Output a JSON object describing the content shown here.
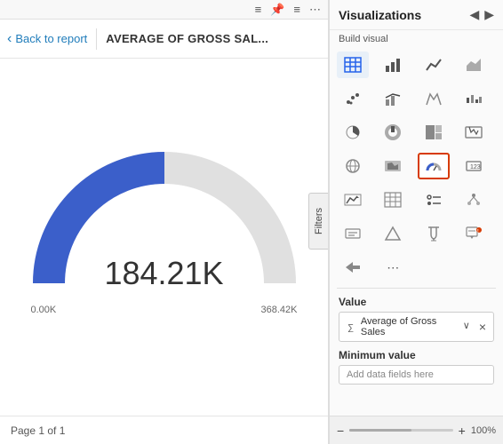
{
  "toolbar": {
    "icons": [
      "≡",
      "📌",
      "≡",
      "…"
    ]
  },
  "nav": {
    "back_label": "Back to report",
    "title": "AVERAGE OF GROSS SAL..."
  },
  "chart": {
    "value": "184.21K",
    "min_label": "0.00K",
    "max_label": "368.42K"
  },
  "filters": {
    "label": "Filters"
  },
  "footer": {
    "page_label": "Page 1 of 1"
  },
  "visualizations": {
    "title": "Visualizations",
    "build_visual_label": "Build visual",
    "nav_left": "◀",
    "nav_right": "▶",
    "value_label": "Value",
    "value_field": "Average of Gross Sales",
    "minimum_value_label": "Minimum value",
    "minimum_value_placeholder": "Add data fields here",
    "zoom_label": "100%",
    "zoom_minus": "−",
    "zoom_plus": "+"
  }
}
